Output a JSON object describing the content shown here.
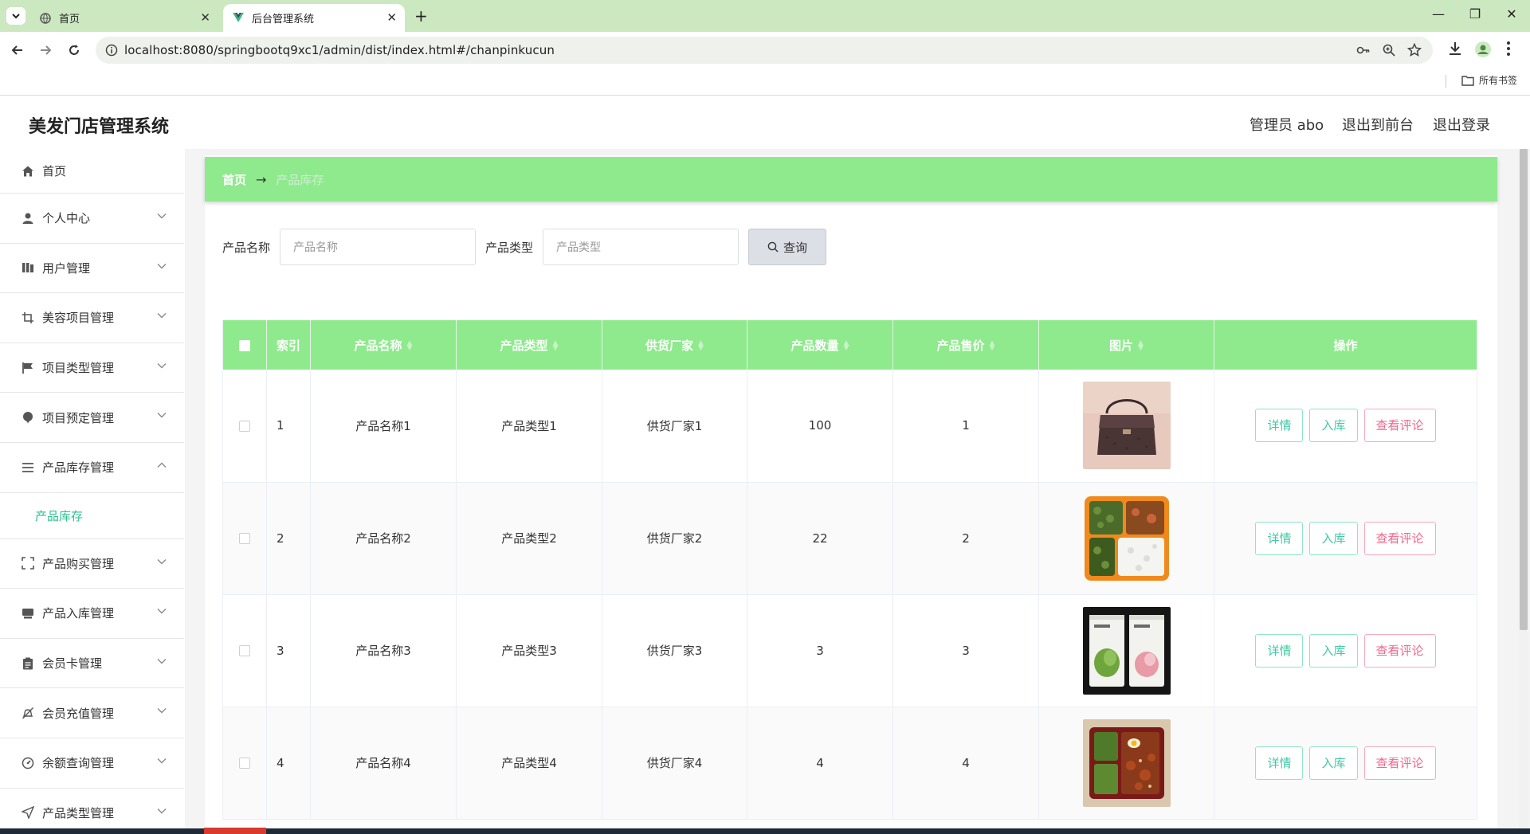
{
  "browser": {
    "tabs": [
      {
        "title": "首页",
        "active": false
      },
      {
        "title": "后台管理系统",
        "active": true
      }
    ],
    "url": "localhost:8080/springbootq9xc1/admin/dist/index.html#/chanpinkucun",
    "bookmarks_folder": "所有书签"
  },
  "header": {
    "title": "美发门店管理系统",
    "user": "管理员 abo",
    "to_front": "退出到前台",
    "logout": "退出登录"
  },
  "sidebar": {
    "items": [
      {
        "label": "首页",
        "icon": "home-icon"
      },
      {
        "label": "个人中心",
        "icon": "user-icon"
      },
      {
        "label": "用户管理",
        "icon": "users-icon"
      },
      {
        "label": "美容项目管理",
        "icon": "crop-icon"
      },
      {
        "label": "项目类型管理",
        "icon": "flag-icon"
      },
      {
        "label": "项目预定管理",
        "icon": "pin-icon"
      },
      {
        "label": "产品库存管理",
        "icon": "list-icon",
        "expanded": true
      },
      {
        "label": "产品购买管理",
        "icon": "scan-icon"
      },
      {
        "label": "产品入库管理",
        "icon": "box-icon"
      },
      {
        "label": "会员卡管理",
        "icon": "clipboard-icon"
      },
      {
        "label": "会员充值管理",
        "icon": "bell-off-icon"
      },
      {
        "label": "余额查询管理",
        "icon": "gauge-icon"
      },
      {
        "label": "产品类型管理",
        "icon": "send-icon"
      }
    ],
    "subitem": "产品库存"
  },
  "breadcrumb": {
    "home": "首页",
    "arrow": "→",
    "current": "产品库存"
  },
  "search": {
    "name_label": "产品名称",
    "name_placeholder": "产品名称",
    "type_label": "产品类型",
    "type_placeholder": "产品类型",
    "button": "查询"
  },
  "table": {
    "columns": [
      "索引",
      "产品名称",
      "产品类型",
      "供货厂家",
      "产品数量",
      "产品售价",
      "图片",
      "操作"
    ],
    "rows": [
      {
        "index": "1",
        "name": "产品名称1",
        "type": "产品类型1",
        "supplier": "供货厂家1",
        "qty": "100",
        "price": "1",
        "image": "handbag"
      },
      {
        "index": "2",
        "name": "产品名称2",
        "type": "产品类型2",
        "supplier": "供货厂家2",
        "qty": "22",
        "price": "2",
        "image": "lunchbox"
      },
      {
        "index": "3",
        "name": "产品名称3",
        "type": "产品类型3",
        "supplier": "供货厂家3",
        "qty": "3",
        "price": "3",
        "image": "facemask"
      },
      {
        "index": "4",
        "name": "产品名称4",
        "type": "产品类型4",
        "supplier": "供货厂家4",
        "qty": "4",
        "price": "4",
        "image": "bento"
      }
    ],
    "actions": {
      "detail": "详情",
      "stock_in": "入库",
      "reviews": "查看评论"
    }
  },
  "colors": {
    "accent_green": "#8fea8d",
    "teal": "#3ec9a4",
    "pink": "#f4678b",
    "tabstrip": "#cce8c0"
  }
}
